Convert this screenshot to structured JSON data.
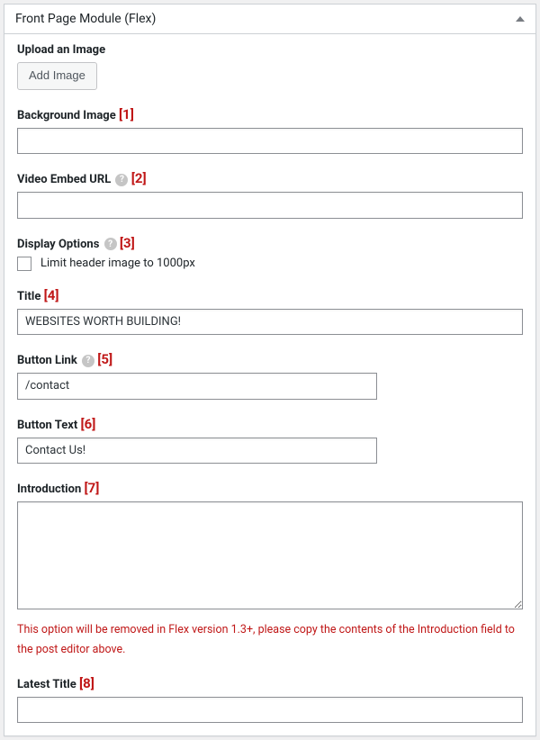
{
  "panel": {
    "title": "Front Page Module (Flex)"
  },
  "fields": {
    "upload": {
      "label": "Upload an Image",
      "button": "Add Image"
    },
    "background_image": {
      "label": "Background Image",
      "annot": "[1]",
      "value": ""
    },
    "video_embed": {
      "label": "Video Embed URL",
      "annot": "[2]",
      "value": ""
    },
    "display_options": {
      "label": "Display Options",
      "annot": "[3]",
      "checkbox_label": "Limit header image to 1000px",
      "checked": false
    },
    "title": {
      "label": "Title",
      "annot": "[4]",
      "value": "WEBSITES WORTH BUILDING!"
    },
    "button_link": {
      "label": "Button Link",
      "annot": "[5]",
      "value": "/contact"
    },
    "button_text": {
      "label": "Button Text",
      "annot": "[6]",
      "value": "Contact Us!"
    },
    "introduction": {
      "label": "Introduction",
      "annot": "[7]",
      "value": "",
      "warning": "This option will be removed in Flex version 1.3+, please copy the contents of the Introduction field to the post editor above."
    },
    "latest_title": {
      "label": "Latest Title",
      "annot": "[8]",
      "value": ""
    }
  }
}
